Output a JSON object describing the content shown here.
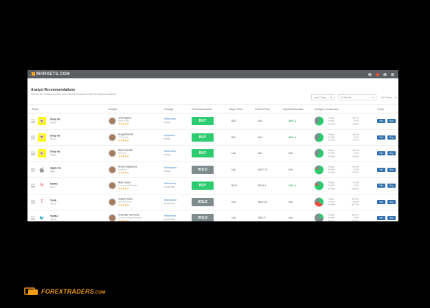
{
  "app": {
    "brand": "MARKETS.COM",
    "title": "Analyst Recommendations",
    "subtitle": "This service analyzes public stock recommendations made by financial analysts",
    "filter_period": "Last 7 Days",
    "filter_status": "All Stocks",
    "filter_extra": "Get Share"
  },
  "columns": [
    "Share",
    "Analyst",
    "Change",
    "Recommendation",
    "Target Price",
    "Current Price",
    "Upside/Downside",
    "Analysts Consensus",
    "Trade"
  ],
  "rows": [
    {
      "name": "Snap Inc",
      "ticker": "SNAP",
      "analyst": "John Egbert",
      "firm": "Wells Fargo",
      "change": "Reiterated",
      "change_sub": "today",
      "reco": "BUY",
      "target": "$25",
      "current": "$14",
      "upside": "18% ▲",
      "legend": [
        "% Buy",
        "% Sell",
        "% Hold"
      ],
      "pcts": [
        "60.0%",
        "0.0%",
        "40.0%"
      ]
    },
    {
      "name": "Snap Inc",
      "ticker": "SNAP",
      "analyst": "Doug Anmuth",
      "firm": "J.P. Morgan",
      "change": "Upgraded",
      "change_sub": "today",
      "reco": "BUY",
      "target": "$20",
      "current": "$14",
      "upside": "43% ▲",
      "legend": [
        "% Buy",
        "% Sell",
        "% Hold"
      ],
      "pcts": [
        "60.0%",
        "0.0%",
        "40.0%"
      ]
    },
    {
      "name": "Snap Inc",
      "ticker": "SNAP",
      "analyst": "Ross Sandler",
      "firm": "Barclays",
      "change": "Reiterated",
      "change_sub": "today",
      "reco": "BUY",
      "target": "N/A",
      "current": "$14",
      "upside": "N/A",
      "legend": [
        "% Buy",
        "% Sell",
        "% Hold"
      ],
      "pcts": [
        "60.0%",
        "0.0%",
        "40.0%"
      ]
    },
    {
      "name": "Apple Inc",
      "ticker": "AAPL",
      "analyst": "Andy Hargreaves",
      "firm": "KeyBanc",
      "change": "Maintained",
      "change_sub": "today",
      "reco": "HOLD",
      "target": "N/A",
      "current": "$197.75",
      "upside": "N/A",
      "legend": [
        "% Buy",
        "% Sell",
        "% Hold"
      ],
      "pcts": [
        "81.5%",
        "4.5%",
        "17.14%"
      ]
    },
    {
      "name": "Netflix",
      "ticker": "NFLX",
      "analyst": "Alan Gould",
      "firm": "Loop Capital Markets",
      "change": "Reiterated",
      "change_sub": "yesterday",
      "reco": "BUY",
      "target": "$413",
      "current": "$344.4",
      "upside": "14% ▲",
      "legend": [
        "% Buy",
        "% Sell",
        "% Hold"
      ],
      "pcts": [
        "77.8%",
        "5.5%",
        "16.66%"
      ]
    },
    {
      "name": "Tesla",
      "ticker": "TSLA",
      "analyst": "Joseph Osha",
      "firm": "JMP Securities",
      "change": "Maintained",
      "change_sub": "yesterday",
      "reco": "HOLD",
      "target": "N/A",
      "current": "$257.28",
      "upside": "N/A",
      "legend": [
        "% Buy",
        "% Sell",
        "% Hold"
      ],
      "pcts": [
        "34.75%",
        "39.9%",
        "26.77%"
      ]
    },
    {
      "name": "Twitter",
      "ticker": "TWTR",
      "analyst": "Chandler Converse",
      "firm": "Consumer Edge Research",
      "change": "Reiterated",
      "change_sub": "yesterday",
      "reco": "HOLD",
      "target": "N/A",
      "current": "$38.77",
      "upside": "N/A",
      "legend": [
        "% Buy",
        "% Sell",
        "% Hold"
      ],
      "pcts": [
        "26.67%",
        "0.0%",
        "75.00%"
      ]
    }
  ],
  "trade": {
    "sell": "Sell",
    "buy": "Buy"
  },
  "stars": "★★★★★",
  "footer_brand": "FOREXTRADERS",
  "footer_domain": ".COM"
}
